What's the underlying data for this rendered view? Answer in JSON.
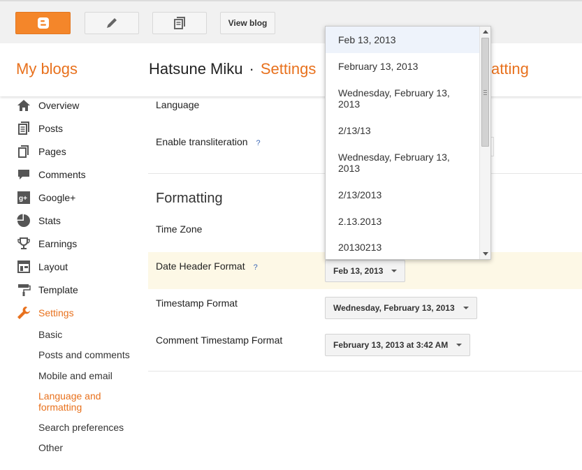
{
  "toolbar": {
    "view_blog_label": "View blog",
    "icons": [
      "blogger-logo-icon",
      "pencil-icon",
      "posts-list-icon"
    ],
    "brand_color": "#f4862a"
  },
  "header": {
    "my_blogs": "My blogs",
    "blog_name": "Hatsune Miku",
    "separator": "·",
    "section": "Settings",
    "section_tail": "atting"
  },
  "sidebar": {
    "items": [
      {
        "label": "Overview",
        "icon": "home-icon"
      },
      {
        "label": "Posts",
        "icon": "posts-icon"
      },
      {
        "label": "Pages",
        "icon": "pages-icon"
      },
      {
        "label": "Comments",
        "icon": "comment-icon"
      },
      {
        "label": "Google+",
        "icon": "google-plus-icon"
      },
      {
        "label": "Stats",
        "icon": "pie-chart-icon"
      },
      {
        "label": "Earnings",
        "icon": "trophy-icon"
      },
      {
        "label": "Layout",
        "icon": "layout-icon"
      },
      {
        "label": "Template",
        "icon": "paint-roller-icon"
      },
      {
        "label": "Settings",
        "icon": "wrench-icon"
      }
    ],
    "sub_items": [
      {
        "label": "Basic"
      },
      {
        "label": "Posts and comments"
      },
      {
        "label": "Mobile and email"
      },
      {
        "label": "Language and formatting"
      },
      {
        "label": "Search preferences"
      },
      {
        "label": "Other"
      }
    ],
    "active_color": "#e8711d"
  },
  "main": {
    "language_label": "Language",
    "transliteration_label": "Enable transliteration",
    "help_mark": "?",
    "formatting_title": "Formatting",
    "timezone_label": "Time Zone",
    "date_header_label": "Date Header Format",
    "date_header_value": "Feb 13, 2013",
    "timestamp_label": "Timestamp Format",
    "timestamp_value": "Wednesday, February 13, 2013",
    "comment_timestamp_label": "Comment Timestamp Format",
    "comment_timestamp_value": "February 13, 2013 at 3:42 AM"
  },
  "dropdown": {
    "options": [
      "Feb 13, 2013",
      "February 13, 2013",
      "Wednesday, February 13, 2013",
      "2/13/13",
      "Wednesday, February 13, 2013",
      "2/13/2013",
      "2.13.2013",
      "20130213"
    ],
    "selected_index": 0
  }
}
